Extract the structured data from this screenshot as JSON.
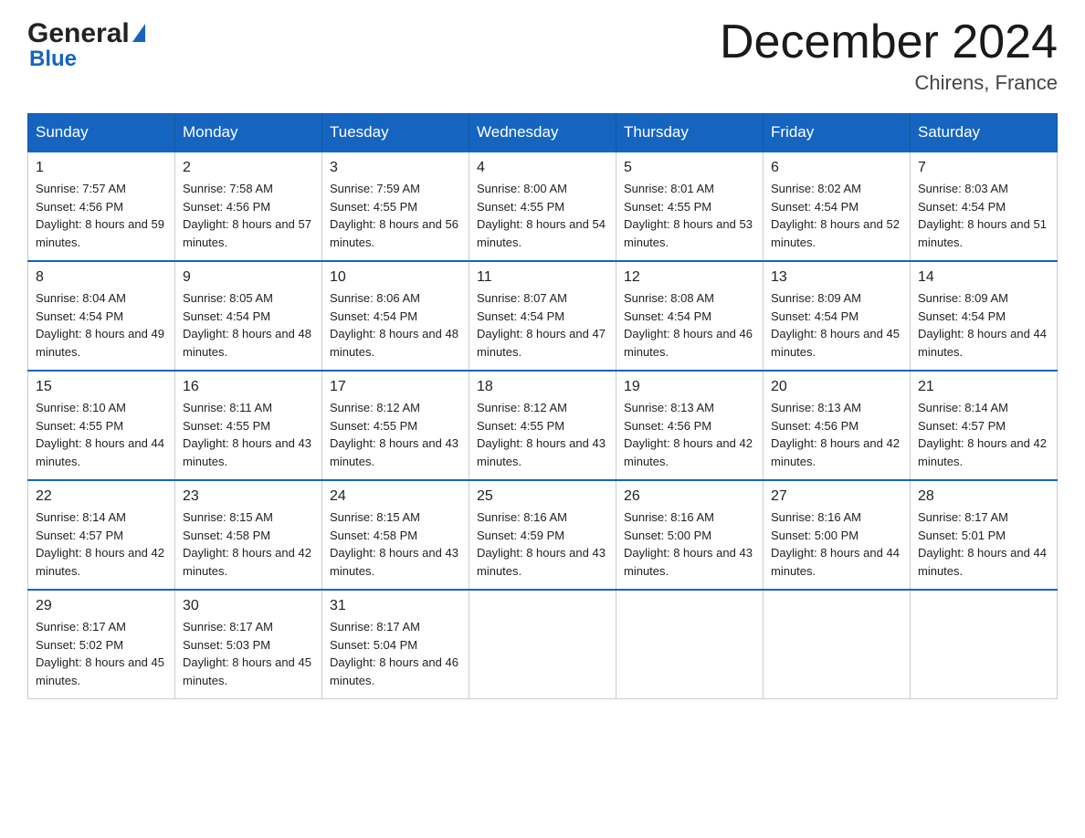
{
  "header": {
    "logo_general": "General",
    "logo_blue": "Blue",
    "month_title": "December 2024",
    "location": "Chirens, France"
  },
  "days_of_week": [
    "Sunday",
    "Monday",
    "Tuesday",
    "Wednesday",
    "Thursday",
    "Friday",
    "Saturday"
  ],
  "weeks": [
    [
      {
        "day": "1",
        "sunrise": "7:57 AM",
        "sunset": "4:56 PM",
        "daylight": "8 hours and 59 minutes."
      },
      {
        "day": "2",
        "sunrise": "7:58 AM",
        "sunset": "4:56 PM",
        "daylight": "8 hours and 57 minutes."
      },
      {
        "day": "3",
        "sunrise": "7:59 AM",
        "sunset": "4:55 PM",
        "daylight": "8 hours and 56 minutes."
      },
      {
        "day": "4",
        "sunrise": "8:00 AM",
        "sunset": "4:55 PM",
        "daylight": "8 hours and 54 minutes."
      },
      {
        "day": "5",
        "sunrise": "8:01 AM",
        "sunset": "4:55 PM",
        "daylight": "8 hours and 53 minutes."
      },
      {
        "day": "6",
        "sunrise": "8:02 AM",
        "sunset": "4:54 PM",
        "daylight": "8 hours and 52 minutes."
      },
      {
        "day": "7",
        "sunrise": "8:03 AM",
        "sunset": "4:54 PM",
        "daylight": "8 hours and 51 minutes."
      }
    ],
    [
      {
        "day": "8",
        "sunrise": "8:04 AM",
        "sunset": "4:54 PM",
        "daylight": "8 hours and 49 minutes."
      },
      {
        "day": "9",
        "sunrise": "8:05 AM",
        "sunset": "4:54 PM",
        "daylight": "8 hours and 48 minutes."
      },
      {
        "day": "10",
        "sunrise": "8:06 AM",
        "sunset": "4:54 PM",
        "daylight": "8 hours and 48 minutes."
      },
      {
        "day": "11",
        "sunrise": "8:07 AM",
        "sunset": "4:54 PM",
        "daylight": "8 hours and 47 minutes."
      },
      {
        "day": "12",
        "sunrise": "8:08 AM",
        "sunset": "4:54 PM",
        "daylight": "8 hours and 46 minutes."
      },
      {
        "day": "13",
        "sunrise": "8:09 AM",
        "sunset": "4:54 PM",
        "daylight": "8 hours and 45 minutes."
      },
      {
        "day": "14",
        "sunrise": "8:09 AM",
        "sunset": "4:54 PM",
        "daylight": "8 hours and 44 minutes."
      }
    ],
    [
      {
        "day": "15",
        "sunrise": "8:10 AM",
        "sunset": "4:55 PM",
        "daylight": "8 hours and 44 minutes."
      },
      {
        "day": "16",
        "sunrise": "8:11 AM",
        "sunset": "4:55 PM",
        "daylight": "8 hours and 43 minutes."
      },
      {
        "day": "17",
        "sunrise": "8:12 AM",
        "sunset": "4:55 PM",
        "daylight": "8 hours and 43 minutes."
      },
      {
        "day": "18",
        "sunrise": "8:12 AM",
        "sunset": "4:55 PM",
        "daylight": "8 hours and 43 minutes."
      },
      {
        "day": "19",
        "sunrise": "8:13 AM",
        "sunset": "4:56 PM",
        "daylight": "8 hours and 42 minutes."
      },
      {
        "day": "20",
        "sunrise": "8:13 AM",
        "sunset": "4:56 PM",
        "daylight": "8 hours and 42 minutes."
      },
      {
        "day": "21",
        "sunrise": "8:14 AM",
        "sunset": "4:57 PM",
        "daylight": "8 hours and 42 minutes."
      }
    ],
    [
      {
        "day": "22",
        "sunrise": "8:14 AM",
        "sunset": "4:57 PM",
        "daylight": "8 hours and 42 minutes."
      },
      {
        "day": "23",
        "sunrise": "8:15 AM",
        "sunset": "4:58 PM",
        "daylight": "8 hours and 42 minutes."
      },
      {
        "day": "24",
        "sunrise": "8:15 AM",
        "sunset": "4:58 PM",
        "daylight": "8 hours and 43 minutes."
      },
      {
        "day": "25",
        "sunrise": "8:16 AM",
        "sunset": "4:59 PM",
        "daylight": "8 hours and 43 minutes."
      },
      {
        "day": "26",
        "sunrise": "8:16 AM",
        "sunset": "5:00 PM",
        "daylight": "8 hours and 43 minutes."
      },
      {
        "day": "27",
        "sunrise": "8:16 AM",
        "sunset": "5:00 PM",
        "daylight": "8 hours and 44 minutes."
      },
      {
        "day": "28",
        "sunrise": "8:17 AM",
        "sunset": "5:01 PM",
        "daylight": "8 hours and 44 minutes."
      }
    ],
    [
      {
        "day": "29",
        "sunrise": "8:17 AM",
        "sunset": "5:02 PM",
        "daylight": "8 hours and 45 minutes."
      },
      {
        "day": "30",
        "sunrise": "8:17 AM",
        "sunset": "5:03 PM",
        "daylight": "8 hours and 45 minutes."
      },
      {
        "day": "31",
        "sunrise": "8:17 AM",
        "sunset": "5:04 PM",
        "daylight": "8 hours and 46 minutes."
      },
      null,
      null,
      null,
      null
    ]
  ]
}
